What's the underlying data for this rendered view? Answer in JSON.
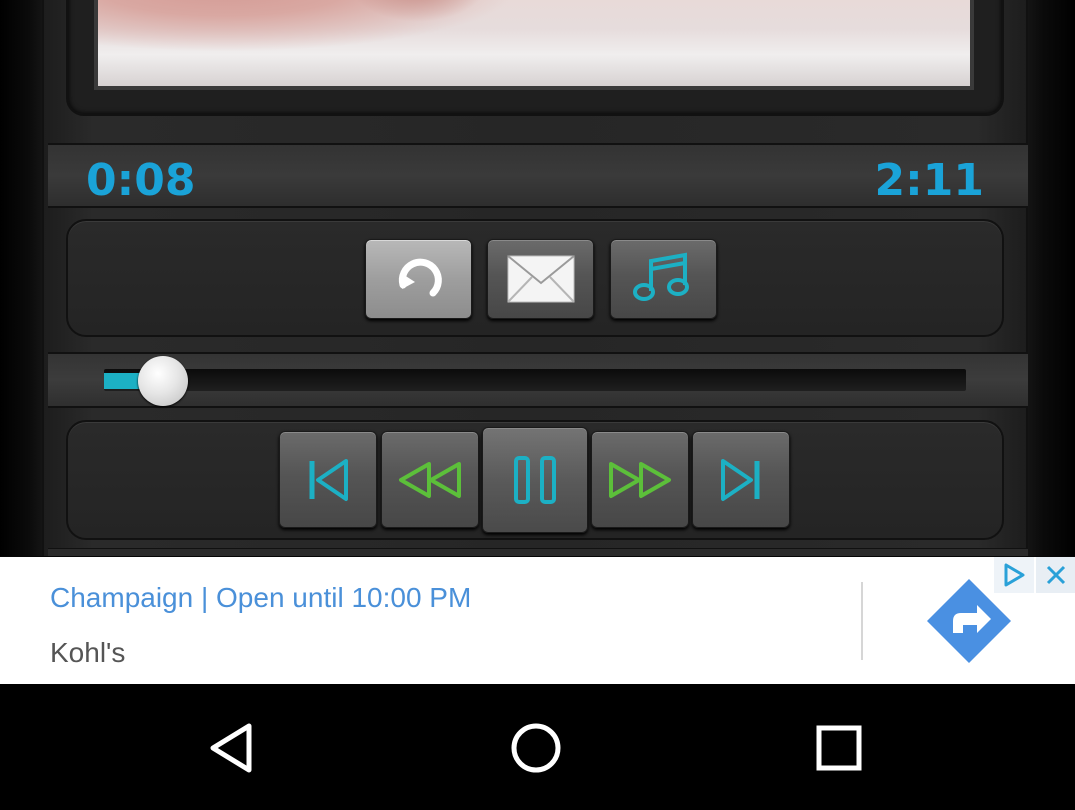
{
  "player": {
    "time_elapsed": "0:08",
    "time_total": "2:11",
    "progress_fraction": 0.069,
    "accent_color": "#1aa3d8",
    "action_buttons": [
      {
        "icon": "repeat-icon"
      },
      {
        "icon": "mail-icon"
      },
      {
        "icon": "music-note-icon"
      }
    ],
    "transport_buttons": [
      {
        "icon": "skip-previous-icon"
      },
      {
        "icon": "rewind-icon"
      },
      {
        "icon": "pause-icon"
      },
      {
        "icon": "fast-forward-icon"
      },
      {
        "icon": "skip-next-icon"
      }
    ]
  },
  "ad": {
    "title": "Champaign | Open until 10:00 PM",
    "advertiser": "Kohl's",
    "cta_icon": "directions-icon",
    "choices_icon": "adchoices-icon",
    "close_icon": "close-icon",
    "brand_color": "#4a90d9"
  },
  "navbar": {
    "buttons": [
      {
        "icon": "back-icon"
      },
      {
        "icon": "home-icon"
      },
      {
        "icon": "recents-icon"
      }
    ]
  }
}
